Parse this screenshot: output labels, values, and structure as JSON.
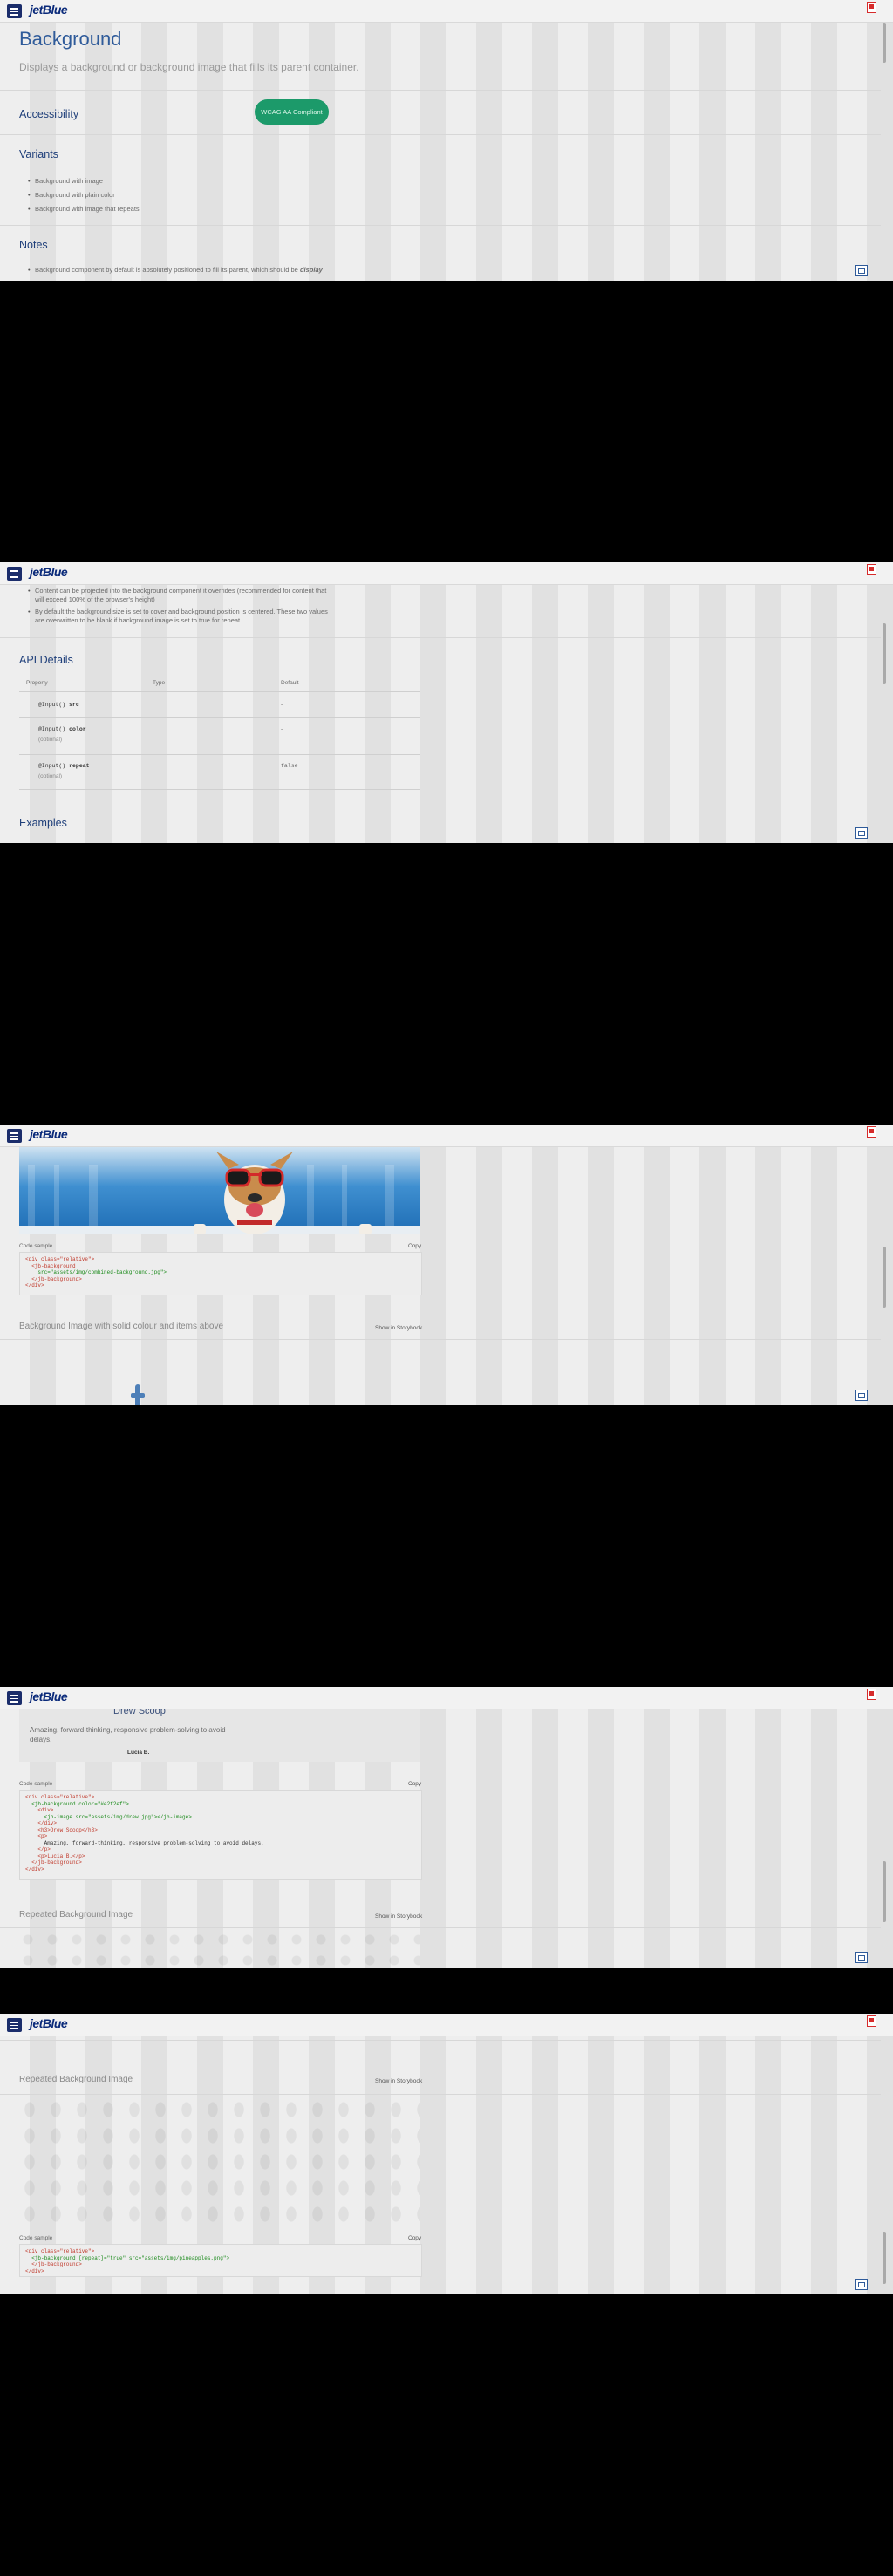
{
  "app": {
    "logo": "jetBlue"
  },
  "page": {
    "title": "Background",
    "subtitle": "Displays a background or background image that fills its parent container.",
    "accessibility_heading": "Accessibility",
    "wcag_button": "WCAG AA Compliant",
    "variants_heading": "Variants",
    "variants": [
      "Background with image",
      "Background with plain color",
      "Background with image that repeats"
    ],
    "notes_heading": "Notes",
    "notes_1a": "Background component by default is absolutely positioned to fill its parent, which should be",
    "notes_1b": "display",
    "notes_2a": "Content can be projected into the background component it overrides (recommended for content that",
    "notes_2b": "will exceed 100% of the browser's height)",
    "notes_3a": "By default the background size is set to cover and background position is centered. These two values",
    "notes_3b": "are overwritten to be blank if background image is set to true for repeat."
  },
  "api": {
    "heading": "API Details",
    "columns": [
      "Property",
      "Type",
      "Default"
    ],
    "rows": [
      {
        "decorator": "@Input()",
        "name": "src",
        "optional": "",
        "default": "-"
      },
      {
        "decorator": "@Input()",
        "name": "color",
        "optional": "(optional)",
        "default": "-"
      },
      {
        "decorator": "@Input()",
        "name": "repeat",
        "optional": "(optional)",
        "default": "false"
      }
    ]
  },
  "examples": {
    "heading": "Examples",
    "code_label": "Code sample",
    "copy_label": "Copy",
    "code1": [
      "<div class=\"relative\">",
      "  <jb-background",
      "    src=\"assets/img/combined-background.jpg\">",
      "  </jb-background>",
      "</div>"
    ],
    "section2_title": "Background Image with solid colour and items above",
    "show_link": "Show in Storybook",
    "quote_name": "Drew Scoop",
    "quote_text_1": "Amazing, forward-thinking, responsive problem-solving to avoid",
    "quote_text_2": "delays.",
    "quote_author": "Lucia B.",
    "code2": [
      "<div class=\"relative\">",
      "  <jb-background color=\"#e2f2ef\">",
      "    <div>",
      "      <jb-image src=\"assets/img/drew.jpg\"></jb-image>",
      "    </div>",
      "    <h3>Drew Scoop</h3>",
      "    <p>",
      "      Amazing, forward-thinking, responsive problem-solving to avoid delays.",
      "    </p>",
      "    <p>Lucia B.</p>",
      "  </jb-background>",
      "</div>"
    ],
    "section3_title": "Repeated Background Image",
    "code3": [
      "<div class=\"relative\">",
      "  <jb-background [repeat]=\"true\" src=\"assets/img/pineapples.png\">",
      "  </jb-background>",
      "</div>"
    ]
  },
  "colors": {
    "brand": "#1b2d6b",
    "accent": "#2f5b9a",
    "wcag": "#1c9a6a",
    "flag": "#d62b2b"
  }
}
